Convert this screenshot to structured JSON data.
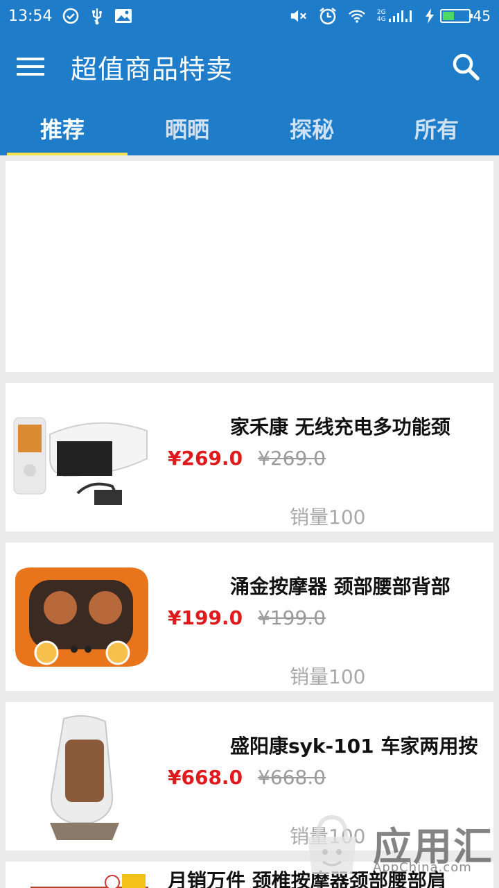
{
  "status_bar": {
    "time": "13:54",
    "net": [
      "2G",
      "4G"
    ],
    "battery": "45",
    "battery_level": 0.45
  },
  "app_bar": {
    "title": "超值商品特卖",
    "menu_icon": "hamburger-menu-icon",
    "search_icon": "search-icon"
  },
  "tabs": [
    {
      "label": "推荐",
      "active": true
    },
    {
      "label": "晒晒",
      "active": false
    },
    {
      "label": "探秘",
      "active": false
    },
    {
      "label": "所有",
      "active": false
    }
  ],
  "products": [
    {
      "name": "家禾康 无线充电多功能颈",
      "price": "¥269.0",
      "original_price": "¥269.0",
      "sales": "销量100"
    },
    {
      "name": "涌金按摩器 颈部腰部背部",
      "price": "¥199.0",
      "original_price": "¥199.0",
      "sales": "销量100"
    },
    {
      "name": "盛阳康syk-101 车家两用按",
      "price": "¥668.0",
      "original_price": "¥668.0",
      "sales": "销量100"
    },
    {
      "name": "月销万件 颈椎按摩器颈部腰部肩"
    }
  ],
  "watermark": {
    "text": "应用汇",
    "sub": "AppChina.com"
  },
  "colors": {
    "primary": "#1e7cc9",
    "price": "#e0191c",
    "tab_indicator": "#f7e14a"
  }
}
